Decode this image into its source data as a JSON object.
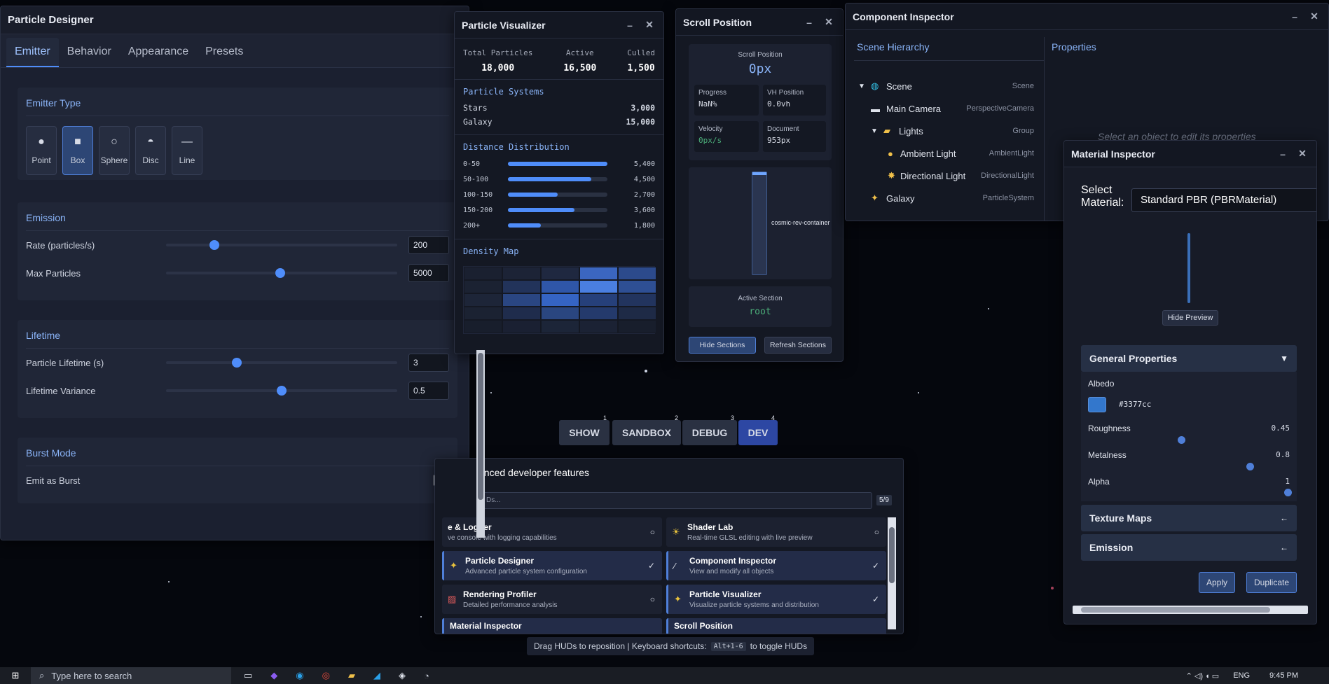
{
  "particle_designer": {
    "title": "Particle Designer",
    "tabs": [
      "Emitter",
      "Behavior",
      "Appearance",
      "Presets"
    ],
    "emitter_type": {
      "heading": "Emitter Type",
      "options": [
        "Point",
        "Box",
        "Sphere",
        "Disc",
        "Line"
      ],
      "selected": "Box"
    },
    "emission": {
      "heading": "Emission",
      "rate_label": "Rate (particles/s)",
      "rate_value": "200",
      "max_label": "Max Particles",
      "max_value": "5000"
    },
    "lifetime": {
      "heading": "Lifetime",
      "life_label": "Particle Lifetime (s)",
      "life_value": "3",
      "var_label": "Lifetime Variance",
      "var_value": "0.5"
    },
    "burst": {
      "heading": "Burst Mode",
      "emit_label": "Emit as Burst"
    }
  },
  "particle_visualizer": {
    "title": "Particle Visualizer",
    "stats": [
      {
        "label": "Total Particles",
        "value": "18,000"
      },
      {
        "label": "Active",
        "value": "16,500"
      },
      {
        "label": "Culled",
        "value": "1,500"
      }
    ],
    "systems_heading": "Particle Systems",
    "systems": [
      {
        "name": "Stars",
        "count": "3,000"
      },
      {
        "name": "Galaxy",
        "count": "15,000"
      }
    ],
    "distribution_heading": "Distance Distribution",
    "distribution": [
      {
        "range": "0-50",
        "value": "5,400",
        "fraction": 1.0
      },
      {
        "range": "50-100",
        "value": "4,500",
        "fraction": 0.84
      },
      {
        "range": "100-150",
        "value": "2,700",
        "fraction": 0.5
      },
      {
        "range": "150-200",
        "value": "3,600",
        "fraction": 0.67
      },
      {
        "range": "200+",
        "value": "1,800",
        "fraction": 0.33
      }
    ],
    "density_heading": "Density Map"
  },
  "scroll_position": {
    "title": "Scroll Position",
    "scroll_label": "Scroll Position",
    "scroll_value": "0px",
    "progress_label": "Progress",
    "progress_value": "NaN%",
    "vh_label": "VH Position",
    "vh_value": "0.0vh",
    "velocity_label": "Velocity",
    "velocity_value": "0px/s",
    "document_label": "Document",
    "document_value": "953px",
    "track_label": "cosmic-rev-container",
    "section_label": "Active Section",
    "section_value": "root",
    "hide_label": "Hide Sections",
    "refresh_label": "Refresh Sections"
  },
  "component_inspector": {
    "title": "Component Inspector",
    "hierarchy_heading": "Scene Hierarchy",
    "properties_heading": "Properties",
    "properties_placeholder": "Select an object to edit its properties",
    "nodes": [
      {
        "name": "Scene",
        "type": "Scene"
      },
      {
        "name": "Main Camera",
        "type": "PerspectiveCamera"
      },
      {
        "name": "Lights",
        "type": "Group"
      },
      {
        "name": "Ambient Light",
        "type": "AmbientLight"
      },
      {
        "name": "Directional Light",
        "type": "DirectionalLight"
      },
      {
        "name": "Galaxy",
        "type": "ParticleSystem"
      }
    ]
  },
  "material_inspector": {
    "title": "Material Inspector",
    "select_label": "Select Material:",
    "select_value": "Standard PBR (PBRMaterial)",
    "hide_preview": "Hide Preview",
    "general_heading": "General Properties",
    "albedo_label": "Albedo",
    "albedo_value": "#3377cc",
    "roughness_label": "Roughness",
    "roughness_value": "0.45",
    "metalness_label": "Metalness",
    "metalness_value": "0.8",
    "alpha_label": "Alpha",
    "alpha_value": "1",
    "texture_heading": "Texture Maps",
    "emission_heading": "Emission",
    "apply_label": "Apply",
    "duplicate_label": "Duplicate"
  },
  "hud": {
    "modes": [
      {
        "label": "SHOW",
        "key": "1"
      },
      {
        "label": "SANDBOX",
        "key": "2"
      },
      {
        "label": "DEBUG",
        "key": "3"
      },
      {
        "label": "DEV",
        "key": "4"
      }
    ],
    "active_mode": "DEV",
    "panel_title": "anced developer features",
    "search_placeholder": "Ds...",
    "count": "5/9",
    "features": [
      {
        "title": "e & Logger",
        "desc": "ve console with logging capabilities",
        "on": false
      },
      {
        "title": "Shader Lab",
        "desc": "Real-time GLSL editing with live preview",
        "on": false
      },
      {
        "title": "Particle Designer",
        "desc": "Advanced particle system configuration",
        "on": true
      },
      {
        "title": "Component Inspector",
        "desc": "View and modify all objects",
        "on": true
      },
      {
        "title": "Rendering Profiler",
        "desc": "Detailed performance analysis",
        "on": false
      },
      {
        "title": "Particle Visualizer",
        "desc": "Visualize particle systems and distribution",
        "on": true
      },
      {
        "title": "Material Inspector",
        "desc": "",
        "on": true
      },
      {
        "title": "Scroll Position",
        "desc": "",
        "on": true
      }
    ],
    "hint_pre": "Drag HUDs to reposition | Keyboard shortcuts:",
    "hint_key": "Alt+1-6",
    "hint_post": "to toggle HUDs"
  },
  "taskbar": {
    "search_placeholder": "Type here to search",
    "lang": "ENG",
    "time": "9:45 PM"
  }
}
